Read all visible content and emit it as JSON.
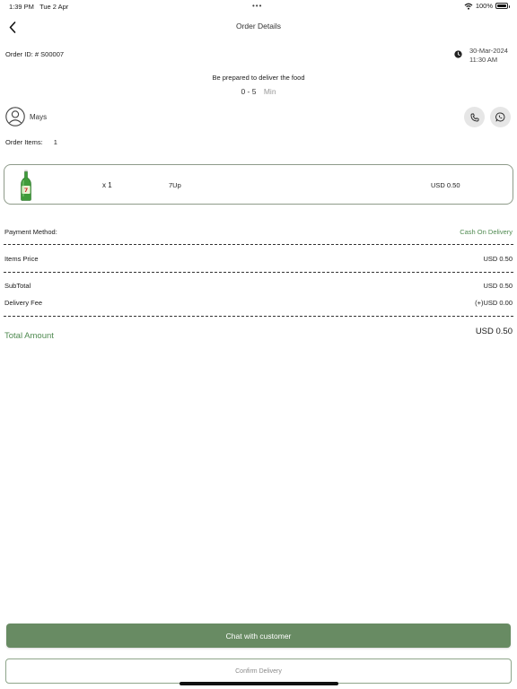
{
  "status_bar": {
    "time": "1:39 PM",
    "date": "Tue 2 Apr",
    "battery": "100%",
    "battery_level": 1.0
  },
  "header": {
    "title": "Order Details"
  },
  "order": {
    "id_label": "Order ID: # S00007",
    "date": "30-Mar-2024",
    "time": "11:30 AM"
  },
  "preparation": {
    "message": "Be prepared to deliver the food",
    "range": "0 - 5",
    "unit": "Min"
  },
  "customer": {
    "name": "Mays"
  },
  "items_summary": {
    "label": "Order Items:",
    "count": "1"
  },
  "items": [
    {
      "qty": "x 1",
      "name": "7Up",
      "price": "USD 0.50"
    }
  ],
  "payment": {
    "label": "Payment Method:",
    "value": "Cash On Delivery"
  },
  "pricing": {
    "items_price_label": "Items Price",
    "items_price_value": "USD 0.50",
    "subtotal_label": "SubTotal",
    "subtotal_value": "USD 0.50",
    "delivery_fee_label": "Delivery Fee",
    "delivery_fee_value": "(+)USD 0.00",
    "total_label": "Total Amount",
    "total_value": "USD 0.50"
  },
  "actions": {
    "chat_label": "Chat with customer",
    "confirm_label": "Confirm Delivery"
  },
  "colors": {
    "accent_green": "#4f8a50",
    "button_green": "#688b63",
    "card_border": "#8e9b8a"
  }
}
